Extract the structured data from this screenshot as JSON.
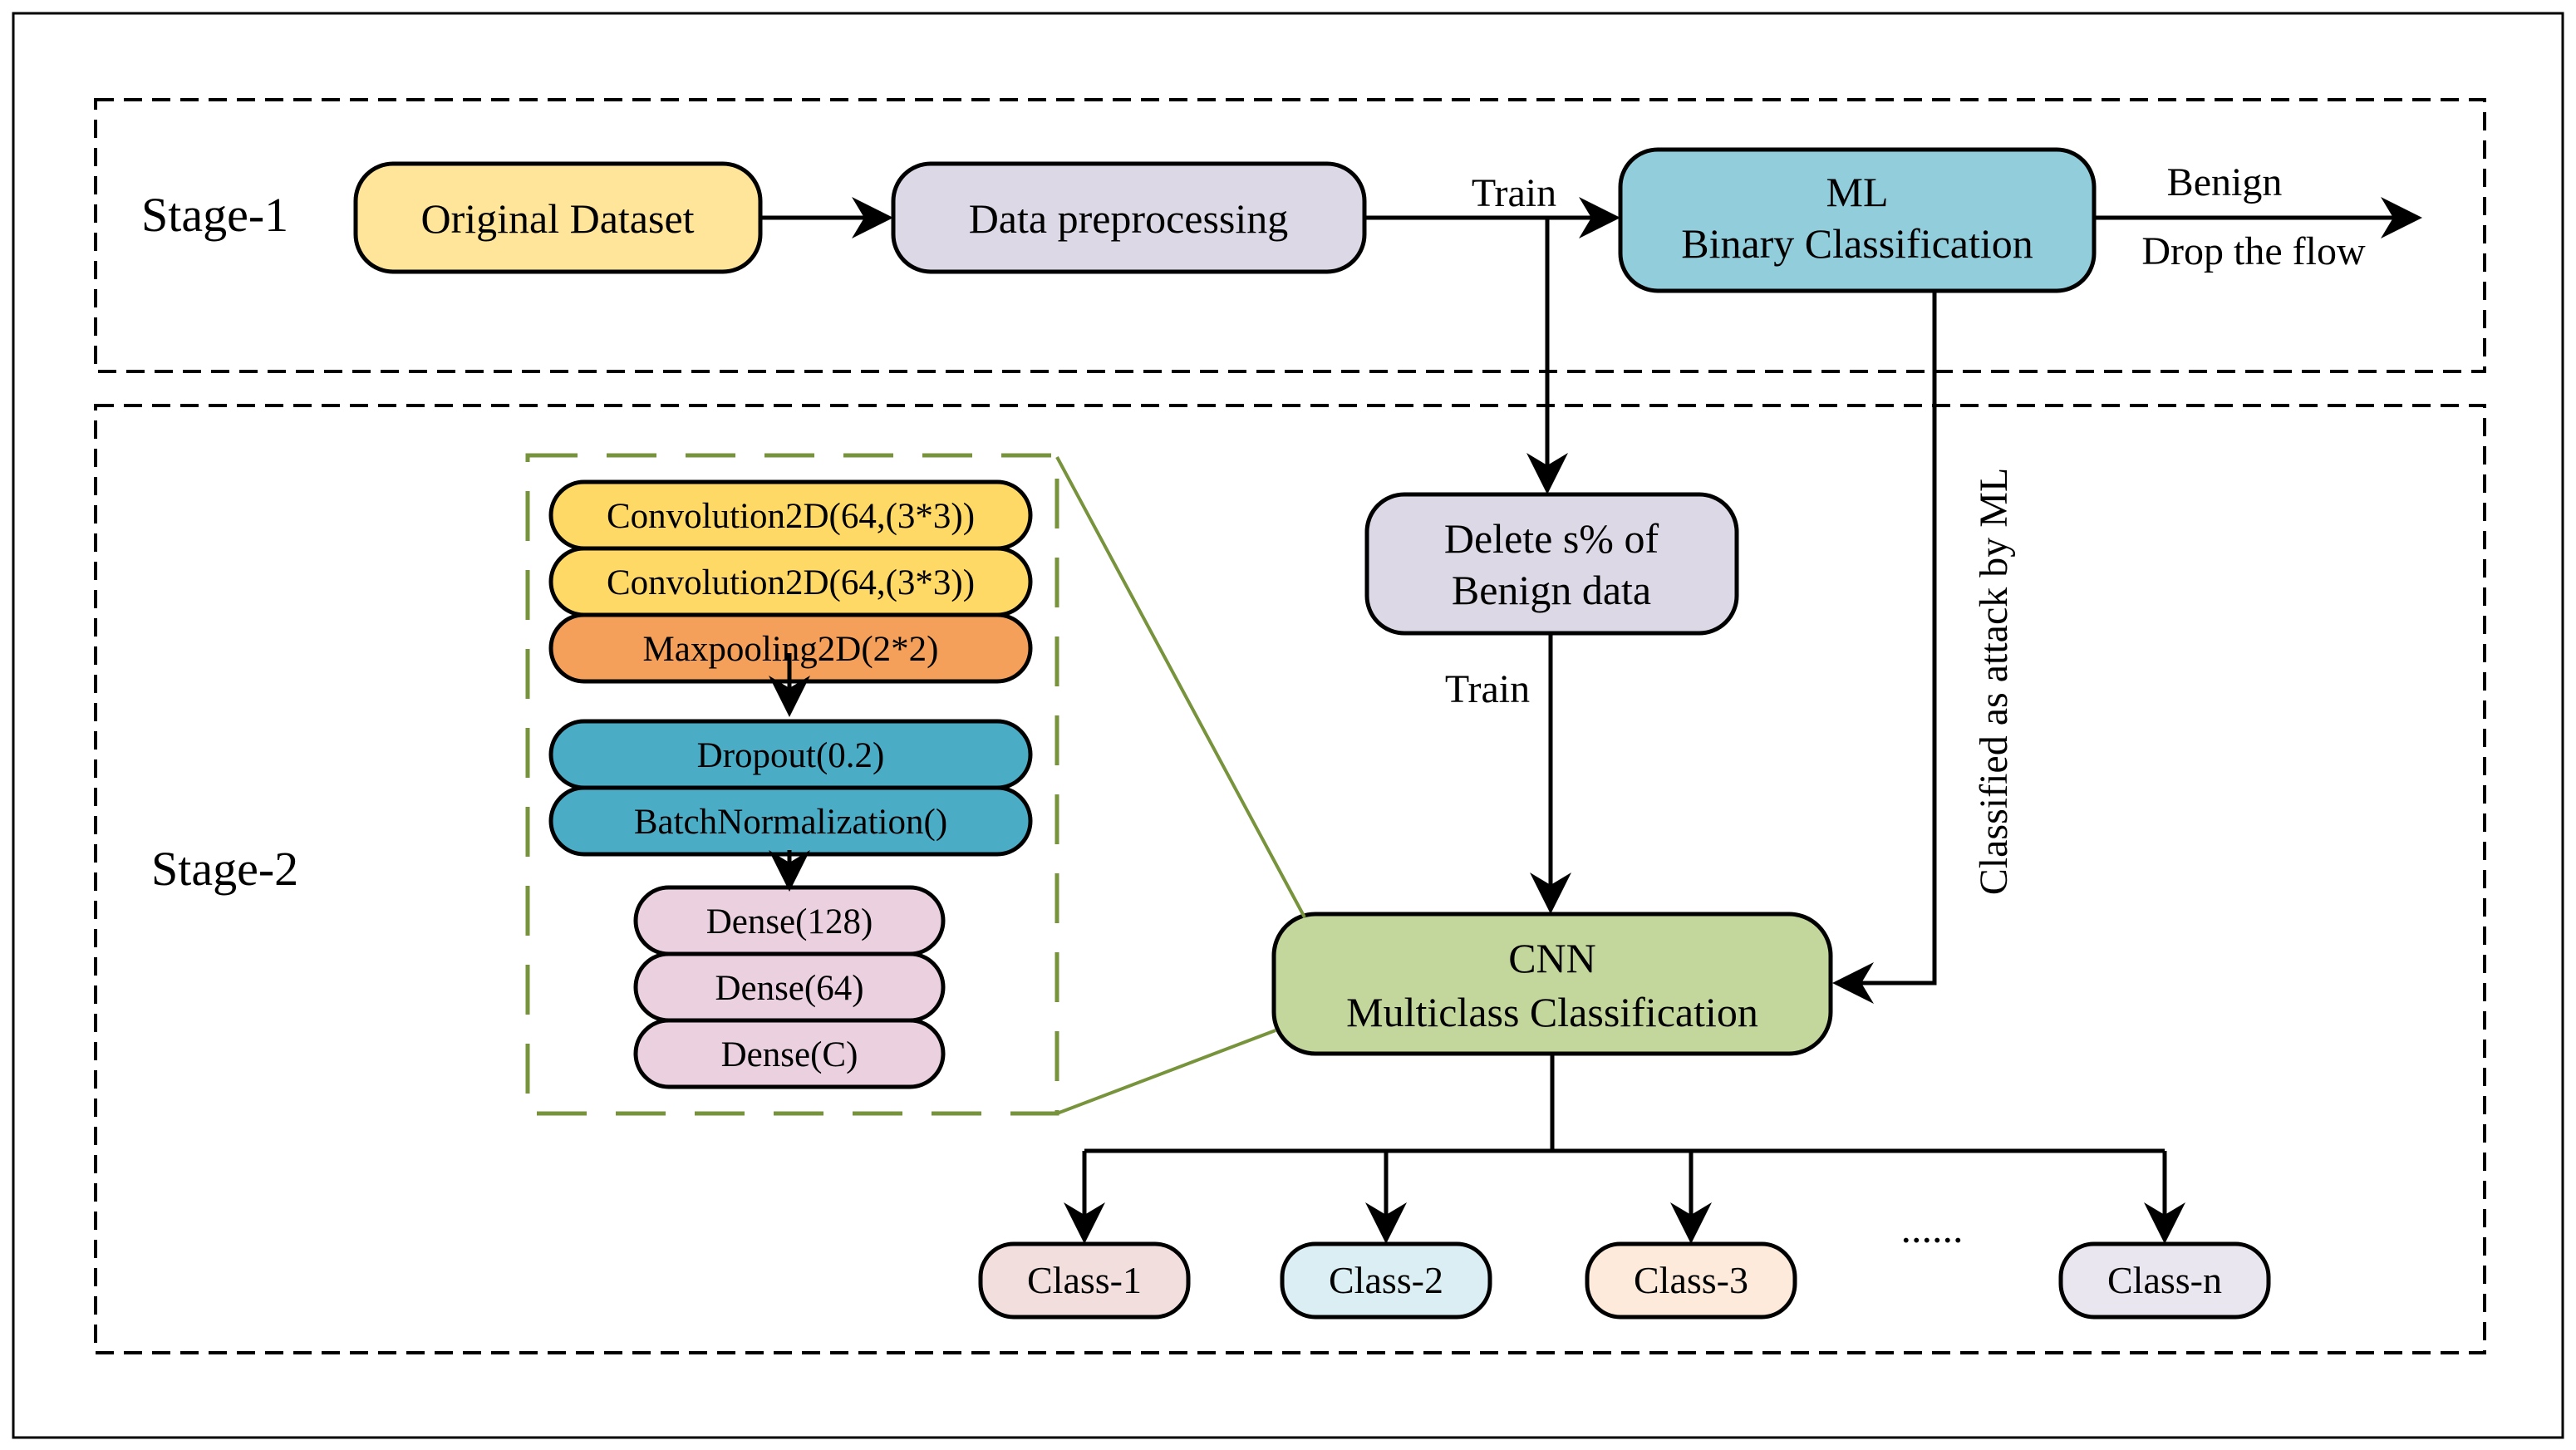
{
  "stages": {
    "stage1": "Stage-1",
    "stage2": "Stage-2"
  },
  "nodes": {
    "original_dataset": "Original Dataset",
    "data_preprocessing": "Data preprocessing",
    "ml_line1": "ML",
    "ml_line2": "Binary Classification",
    "delete_line1": "Delete s% of",
    "delete_line2": "Benign data",
    "cnn_line1": "CNN",
    "cnn_line2": "Multiclass Classification"
  },
  "edge_labels": {
    "train_top": "Train",
    "train_mid": "Train",
    "benign": "Benign",
    "drop": "Drop the flow",
    "classified_attack": "Classified as attack by ML"
  },
  "cnn_layers": [
    {
      "label": "Convolution2D(64,(3*3))",
      "color": "#FFD966"
    },
    {
      "label": "Convolution2D(64,(3*3))",
      "color": "#FFD966"
    },
    {
      "label": "Maxpooling2D(2*2)",
      "color": "#F4A05A"
    },
    {
      "label": "Dropout(0.2)",
      "color": "#4BACC6"
    },
    {
      "label": "BatchNormalization()",
      "color": "#4BACC6"
    },
    {
      "label": "Dense(128)",
      "color": "#EBD0E0"
    },
    {
      "label": "Dense(64)",
      "color": "#EBD0E0"
    },
    {
      "label": "Dense(C)",
      "color": "#EBD0E0"
    }
  ],
  "classes": [
    {
      "label": "Class-1",
      "color": "#F2DFDD"
    },
    {
      "label": "Class-2",
      "color": "#DBEEF4"
    },
    {
      "label": "Class-3",
      "color": "#FDEADA"
    },
    {
      "label": "Class-n",
      "color": "#E9E6EF"
    }
  ],
  "ellipsis": "......",
  "colors": {
    "original_dataset": "#FFE599",
    "data_preprocessing": "#DDD8E6",
    "ml": "#92CDDC",
    "delete": "#DDD8E6",
    "cnn": "#C3D69B",
    "zoom_frame": "#77933C"
  }
}
